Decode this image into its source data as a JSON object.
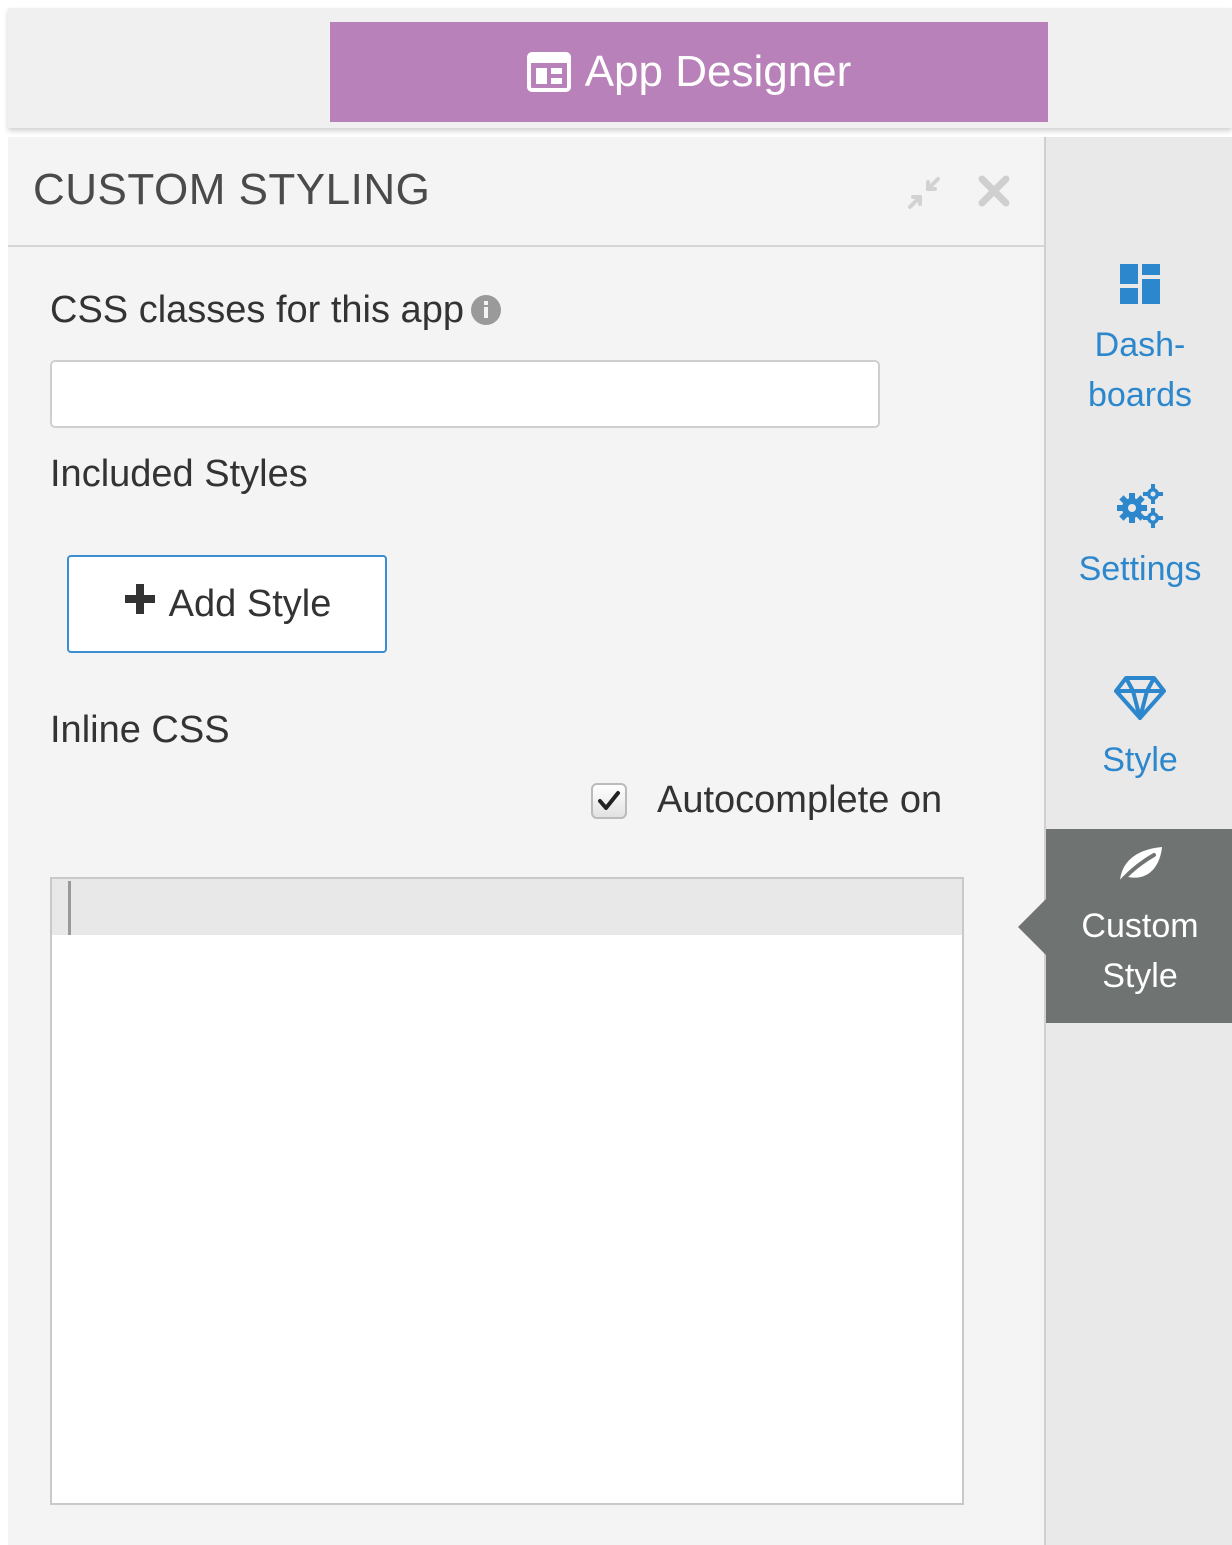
{
  "header": {
    "app_tab_label": "App Designer",
    "app_tab_icon": "layout-icon",
    "app_tab_color": "#b981b9"
  },
  "panel": {
    "title": "CUSTOM STYLING",
    "header_icons": [
      "minimize-icon",
      "close-icon"
    ],
    "css_classes_label": "CSS classes for this app",
    "css_classes_value": "",
    "included_styles_label": "Included Styles",
    "add_style_label": "Add Style",
    "inline_css_label": "Inline CSS",
    "autocomplete_label": "Autocomplete on",
    "autocomplete_checked": true,
    "inline_css_value": ""
  },
  "side_nav": {
    "accent_color": "#2c87cc",
    "active_bg": "#6f7473",
    "items": [
      {
        "label": "Dash-\nboards",
        "icon": "dashboards-icon",
        "active": false
      },
      {
        "label": "Settings",
        "icon": "gears-icon",
        "active": false
      },
      {
        "label": "Style",
        "icon": "diamond-icon",
        "active": false
      },
      {
        "label": "Custom\nStyle",
        "icon": "leaf-icon",
        "active": true
      }
    ]
  }
}
